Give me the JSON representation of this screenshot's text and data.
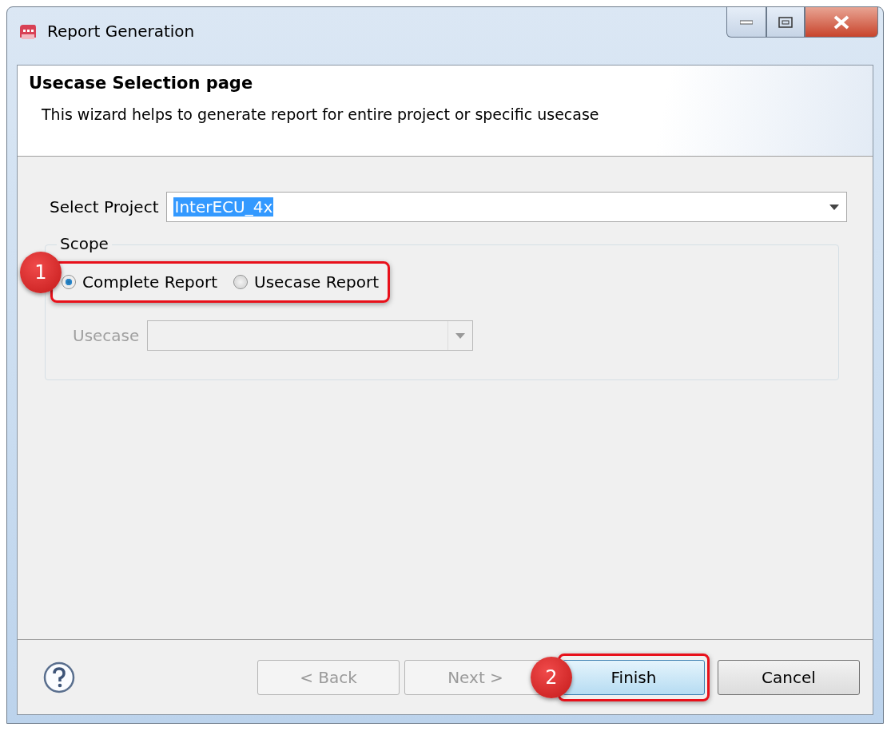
{
  "window": {
    "title": "Report Generation"
  },
  "header": {
    "title": "Usecase Selection page",
    "description": "This wizard helps to generate report for entire project or specific usecase"
  },
  "project": {
    "label": "Select Project",
    "value": "InterECU_4x"
  },
  "scope": {
    "legend": "Scope",
    "options": [
      {
        "label": "Complete Report",
        "selected": true
      },
      {
        "label": "Usecase Report",
        "selected": false
      }
    ],
    "usecase": {
      "label": "Usecase",
      "disabled": true
    }
  },
  "buttons": [
    {
      "label": "< Back",
      "disabled": true,
      "default": false
    },
    {
      "label": "Next >",
      "disabled": true,
      "default": false
    },
    {
      "label": "Finish",
      "disabled": false,
      "default": true
    },
    {
      "label": "Cancel",
      "disabled": false,
      "default": false
    }
  ],
  "callouts": [
    {
      "number": "1"
    },
    {
      "number": "2"
    }
  ]
}
